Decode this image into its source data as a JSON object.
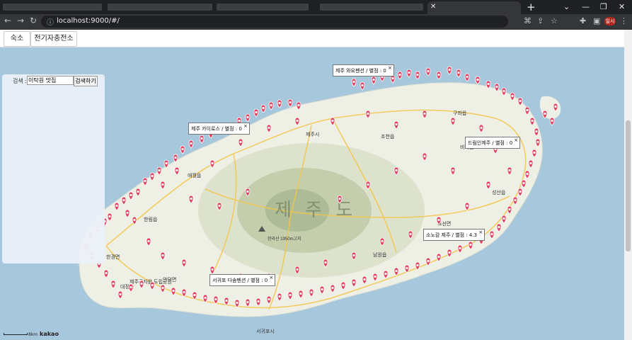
{
  "browser": {
    "url": "localhost:9000/#/",
    "profile_badge": "일시"
  },
  "header": {
    "buttons": [
      "숙소",
      "전기자충전소"
    ]
  },
  "search": {
    "label": "검색 :",
    "value": "이탁원 맛집",
    "button": "검색하기"
  },
  "map": {
    "island_label": "제 주 도",
    "place_labels": [
      "제주시",
      "서귀포시",
      "한림읍",
      "애월읍",
      "조천읍",
      "구좌읍",
      "성산읍",
      "표선면",
      "남원읍",
      "한경면",
      "대정읍",
      "안덕면",
      "비자림",
      "한라산 1950m고지",
      "제주곶자왈 도립공원"
    ],
    "scale_label": "8km",
    "logo": "kakao",
    "colors": {
      "sea": "#a7c7dc",
      "land": "#eef0e6",
      "marker": "#e0415f"
    }
  },
  "info_windows": [
    "제주 와요펜션 / 별점 : 0",
    "제주 카이로스 / 별점 : 0",
    "드림인제주 / 별점 : 0",
    "소노캄 제주 / 별점 : 4.3",
    "서귀포 다솜펜션 / 별점 : 0"
  ]
}
